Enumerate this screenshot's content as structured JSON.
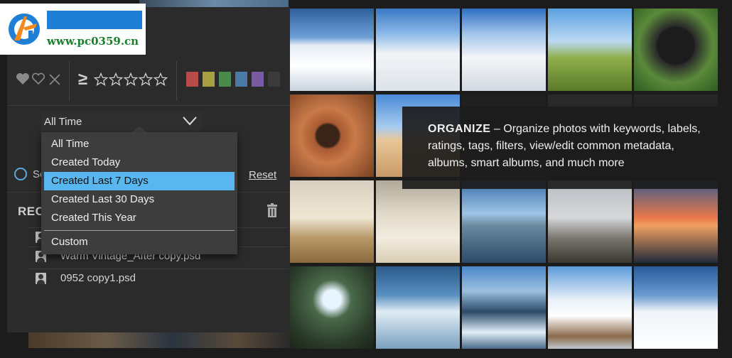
{
  "logo": {
    "url_text": "www.pc0359.cn",
    "brand_color": "#1f7fd6",
    "text_color": "#1a7f2c"
  },
  "filters": {
    "heart_icon": "heart-icon",
    "heart_outline_icon": "heart-outline-icon",
    "reject_icon": "x-icon",
    "rating_operator": "≥",
    "star_count": 5,
    "color_labels": [
      "#b84a4a",
      "#a8a040",
      "#4a8a4a",
      "#4a7aa8",
      "#7a5aa0",
      "#3a3a3a"
    ]
  },
  "time_filter": {
    "selected": "All Time",
    "options": [
      "All Time",
      "Created Today",
      "Created Last 7 Days",
      "Created Last 30 Days",
      "Created This Year",
      "Custom"
    ],
    "highlighted": "Created Last 7 Days"
  },
  "search": {
    "partial_label": "Se",
    "reset_label": "Reset"
  },
  "recent": {
    "title": "RECI",
    "files": [
      "Warm Vintage_After copy.psd",
      "0952 copy1.psd"
    ]
  },
  "callout": {
    "title": "ORGANIZE",
    "body": " – Organize photos with keywords, labels, ratings, tags, filters, view/edit common metadata, albums, smart albums, and much more"
  },
  "colors": {
    "accent": "#59b7ef",
    "panel": "#2b2b2b",
    "menu": "#3d3d3d"
  }
}
